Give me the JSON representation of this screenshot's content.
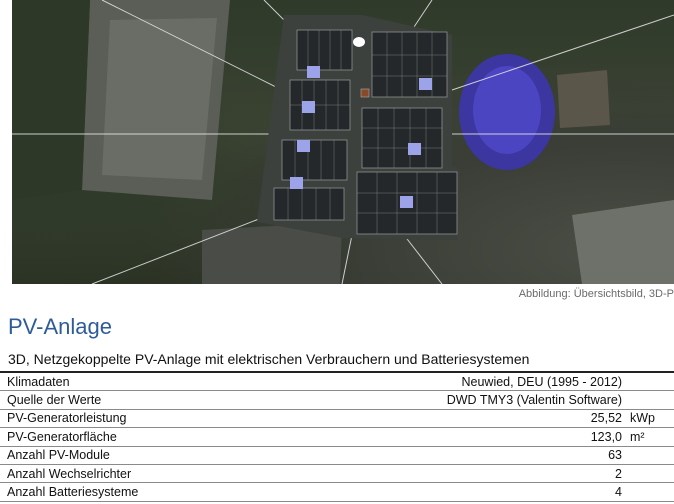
{
  "figure": {
    "caption": "Abbildung: Übersichtsbild, 3D-P"
  },
  "section": {
    "heading": "PV-Anlage",
    "subtitle": "3D, Netzgekoppelte PV-Anlage mit elektrischen Verbrauchern und Batteriesystemen"
  },
  "rows": [
    {
      "label": "Klimadaten",
      "value": "Neuwied, DEU (1995 - 2012)",
      "unit": ""
    },
    {
      "label": "Quelle der Werte",
      "value": "DWD TMY3 (Valentin Software)",
      "unit": ""
    },
    {
      "label": "PV-Generatorleistung",
      "value": "25,52",
      "unit": "kWp"
    },
    {
      "label": "PV-Generatorfläche",
      "value": "123,0",
      "unit": "m²"
    },
    {
      "label": "Anzahl PV-Module",
      "value": "63",
      "unit": ""
    },
    {
      "label": "Anzahl Wechselrichter",
      "value": "2",
      "unit": ""
    },
    {
      "label": "Anzahl Batteriesysteme",
      "value": "4",
      "unit": ""
    }
  ]
}
